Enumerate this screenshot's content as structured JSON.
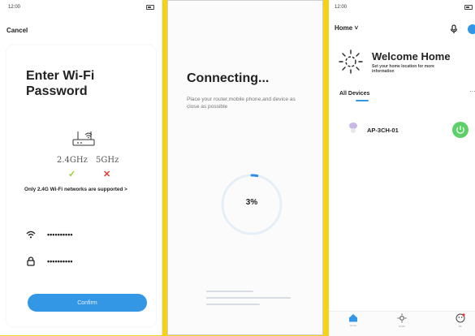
{
  "panel1": {
    "time": "12:00",
    "cancel": "Cancel",
    "title_line1": "Enter Wi-Fi",
    "title_line2": "Password",
    "band_24": "2.4GHz",
    "band_5": "5GHz",
    "mark_ok": "✓",
    "mark_no": "✕",
    "support_note": "Only 2.4G Wi-Fi networks are supported >",
    "wifi_name": "••••••••••",
    "password": "••••••••••",
    "confirm": "Confirm",
    "colors": {
      "accent": "#3397e6",
      "ok": "#9acd32",
      "no": "#e53935"
    }
  },
  "panel2": {
    "title": "Connecting...",
    "description": "Place your router,mobile phone,and device as close as possible",
    "percent_label": "3%",
    "progress": 0.03
  },
  "panel3": {
    "time": "12:00",
    "home_selector": "Home ˅",
    "welcome_title": "Welcome Home",
    "welcome_sub": "Set your home location for more information",
    "all_devices": "All Devices",
    "more": "···",
    "device_name": "AP-3CH-01",
    "tabs": [
      {
        "icon": "home-icon",
        "label": "Home"
      },
      {
        "icon": "scene-icon",
        "label": "Smart"
      },
      {
        "icon": "profile-icon",
        "label": "Me"
      }
    ],
    "colors": {
      "power": "#5fcf6a",
      "tab_active": "#3397e6"
    }
  }
}
